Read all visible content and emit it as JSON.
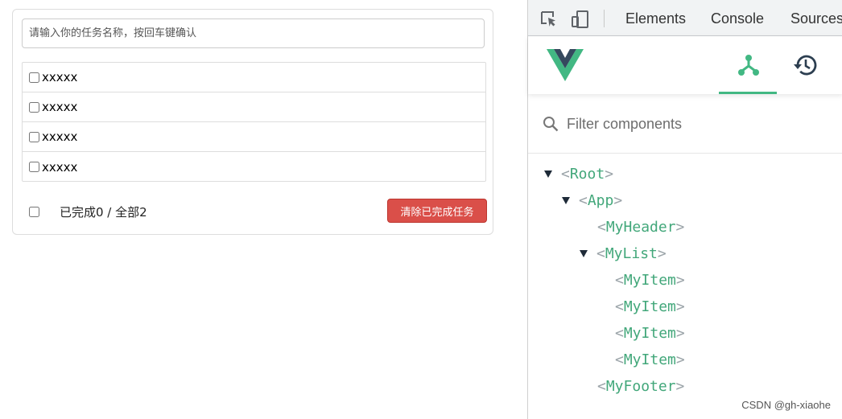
{
  "todo": {
    "input": {
      "placeholder": "请输入你的任务名称，按回车键确认",
      "value": ""
    },
    "items": [
      {
        "title": "xxxxx",
        "done": false
      },
      {
        "title": "xxxxx",
        "done": false
      },
      {
        "title": "xxxxx",
        "done": false
      },
      {
        "title": "xxxxx",
        "done": false
      }
    ],
    "footer": {
      "count_text": "已完成0 / 全部2",
      "clear_label": "清除已完成任务"
    }
  },
  "devtools": {
    "toolbar": {
      "icons": [
        "inspect-element-icon",
        "device-toolbar-icon"
      ],
      "tabs": [
        "Elements",
        "Console",
        "Sources"
      ]
    },
    "vue": {
      "logo": "vue-logo",
      "tabs": [
        {
          "icon": "component-tree-icon",
          "active": true
        },
        {
          "icon": "history-icon",
          "active": false
        }
      ],
      "filter": {
        "placeholder": "Filter components",
        "icon": "search-icon"
      },
      "tree": [
        {
          "name": "Root",
          "depth": 0,
          "expanded": true
        },
        {
          "name": "App",
          "depth": 1,
          "expanded": true
        },
        {
          "name": "MyHeader",
          "depth": 2,
          "expanded": false
        },
        {
          "name": "MyList",
          "depth": 2,
          "expanded": true
        },
        {
          "name": "MyItem",
          "depth": 3,
          "expanded": false
        },
        {
          "name": "MyItem",
          "depth": 3,
          "expanded": false
        },
        {
          "name": "MyItem",
          "depth": 3,
          "expanded": false
        },
        {
          "name": "MyItem",
          "depth": 3,
          "expanded": false
        },
        {
          "name": "MyFooter",
          "depth": 2,
          "expanded": false
        }
      ]
    }
  },
  "watermark": "CSDN @gh-xiaohe",
  "colors": {
    "vue_green": "#42b883",
    "vue_dark": "#35495e",
    "danger": "#da4f49",
    "node_name": "#42a77a"
  }
}
